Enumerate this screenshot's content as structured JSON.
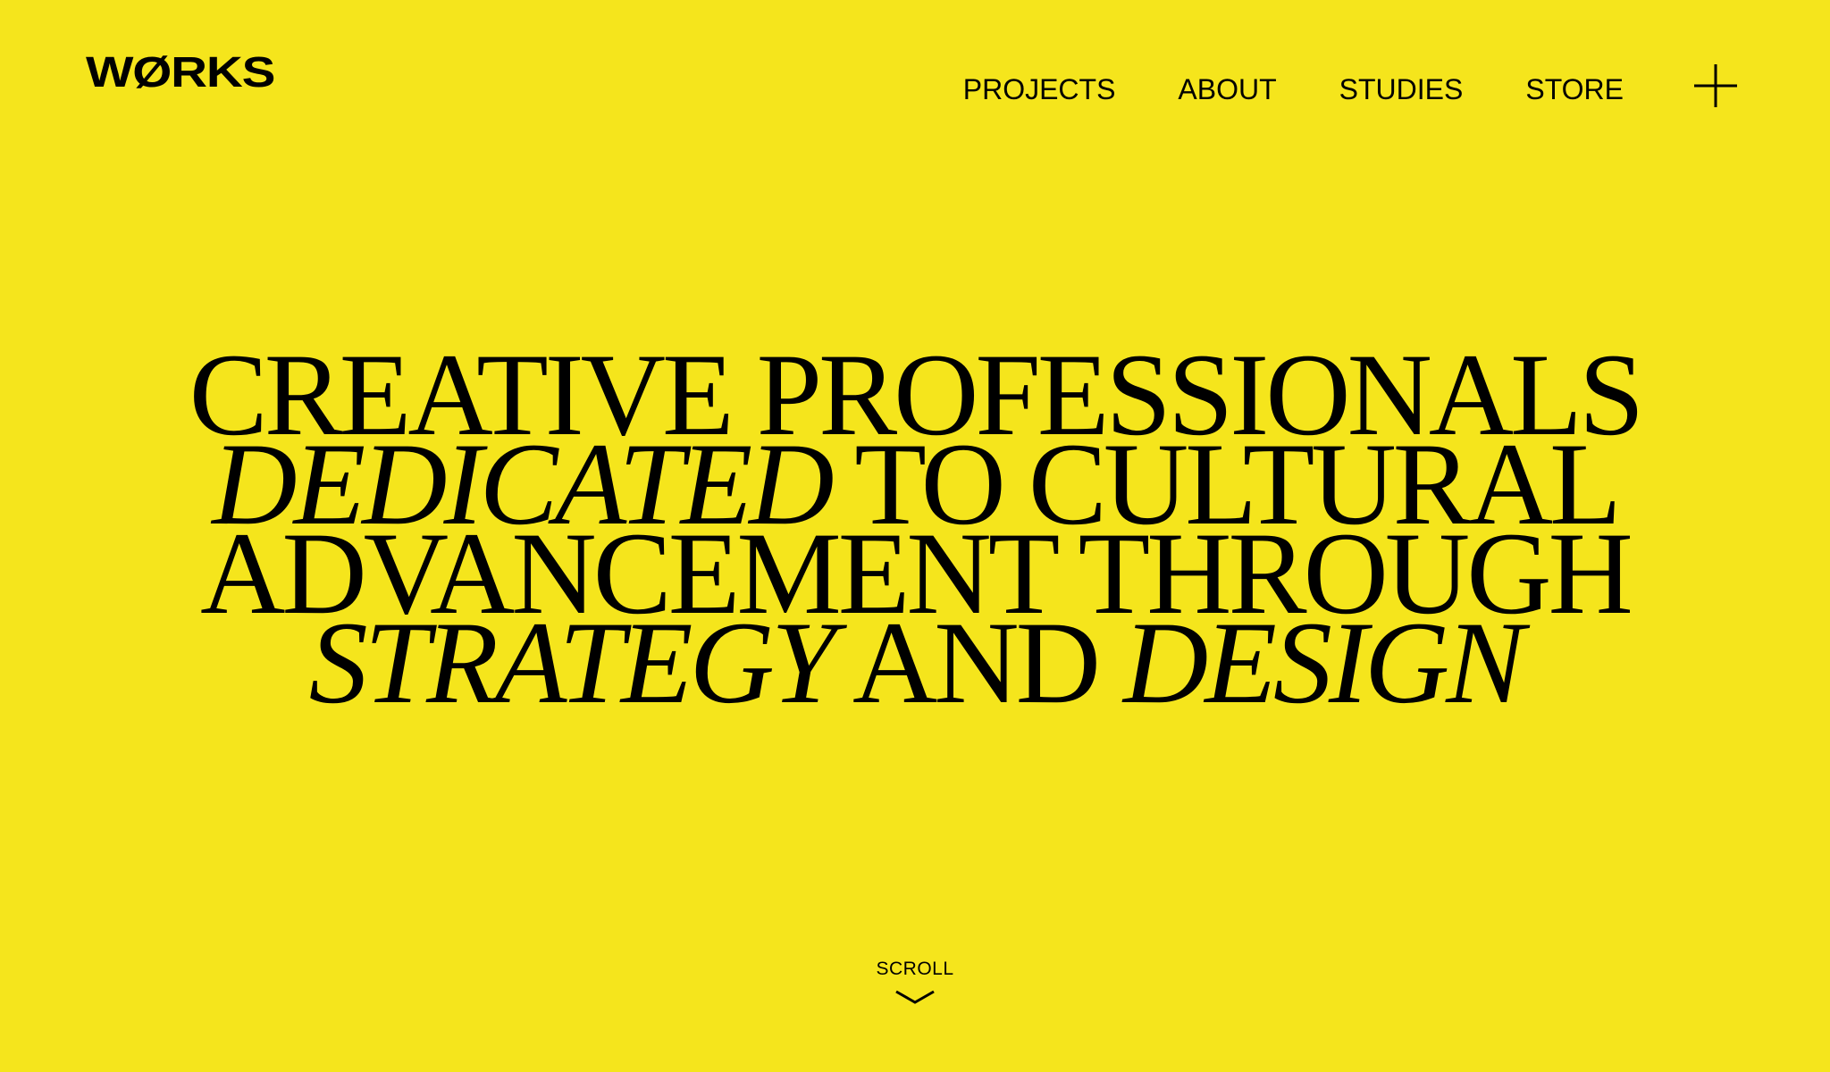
{
  "header": {
    "logo_text": "WØRKS",
    "nav": [
      {
        "label": "PROJECTS"
      },
      {
        "label": "ABOUT"
      },
      {
        "label": "STUDIES"
      },
      {
        "label": "STORE"
      }
    ],
    "menu_icon": "plus-icon"
  },
  "hero": {
    "line1": "CREATIVE PROFESSIONALS",
    "line2_italic": "DEDICATED",
    "line2_rest": " TO CULTURAL",
    "line3": "ADVANCEMENT THROUGH",
    "line4_italic_a": "STRATEGY",
    "line4_mid": " AND ",
    "line4_italic_b": "DESIGN"
  },
  "scroll": {
    "label": "SCROLL",
    "icon": "chevron-down-icon"
  },
  "colors": {
    "background": "#F5E51C",
    "text": "#000000"
  }
}
